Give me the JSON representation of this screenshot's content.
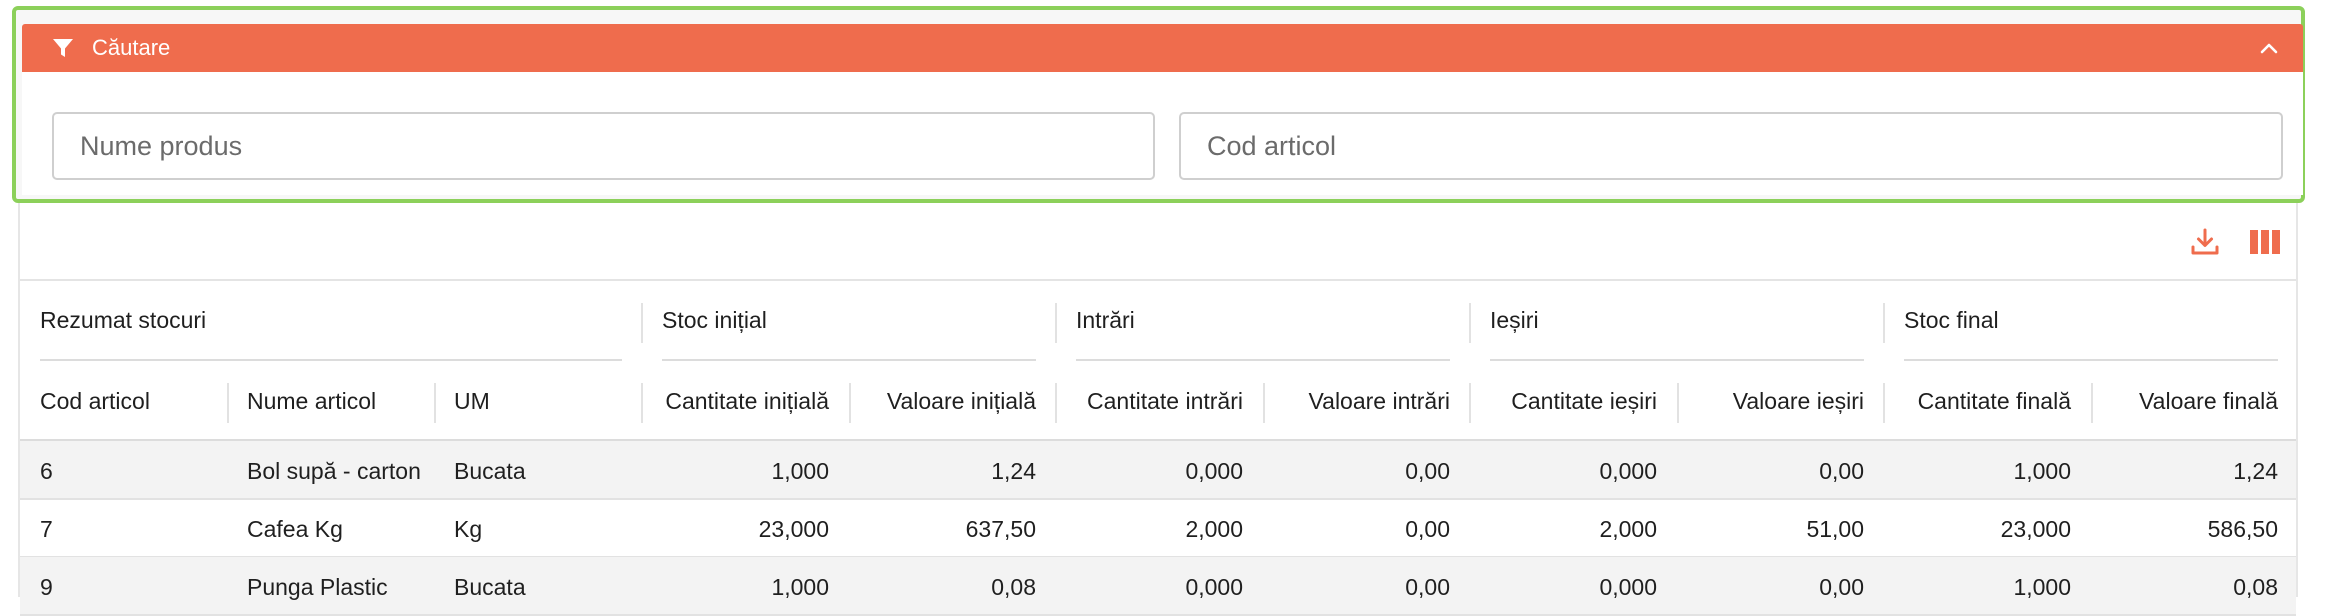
{
  "search": {
    "title": "Căutare",
    "fields": {
      "product_name_placeholder": "Nume produs",
      "product_name_value": "",
      "article_code_placeholder": "Cod articol",
      "article_code_value": ""
    }
  },
  "colors": {
    "accent": "#ef6c4d",
    "focus_border": "#8cd05a"
  },
  "toolbar": {
    "download_icon": "download-icon",
    "columns_icon": "columns-icon"
  },
  "table": {
    "groups": [
      "Rezumat stocuri",
      "Stoc inițial",
      "Intrări",
      "Ieșiri",
      "Stoc final"
    ],
    "columns": [
      "Cod articol",
      "Nume articol",
      "UM",
      "Cantitate inițială",
      "Valoare inițială",
      "Cantitate intrări",
      "Valoare intrări",
      "Cantitate ieșiri",
      "Valoare ieșiri",
      "Cantitate finală",
      "Valoare finală"
    ],
    "rows": [
      [
        "6",
        "Bol supă - carton",
        "Bucata",
        "1,000",
        "1,24",
        "0,000",
        "0,00",
        "0,000",
        "0,00",
        "1,000",
        "1,24"
      ],
      [
        "7",
        "Cafea Kg",
        "Kg",
        "23,000",
        "637,50",
        "2,000",
        "0,00",
        "2,000",
        "51,00",
        "23,000",
        "586,50"
      ],
      [
        "9",
        "Punga Plastic",
        "Bucata",
        "1,000",
        "0,08",
        "0,000",
        "0,00",
        "0,000",
        "0,00",
        "1,000",
        "0,08"
      ]
    ]
  }
}
